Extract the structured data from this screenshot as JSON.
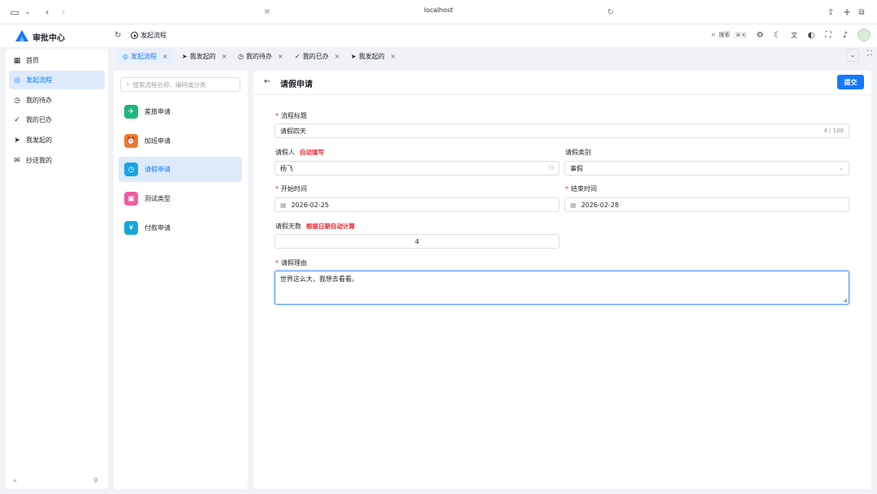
{
  "browser": {
    "url": "localhost"
  },
  "app": {
    "title": "审批中心"
  },
  "header": {
    "breadcrumb": "发起流程",
    "search_label": "搜索",
    "search_shortcut": "⌘ K"
  },
  "sidebar": {
    "items": [
      {
        "label": "首页",
        "icon": "dashboard-icon"
      },
      {
        "label": "发起流程",
        "icon": "play-circle-icon",
        "active": true
      },
      {
        "label": "我的待办",
        "icon": "clock-icon"
      },
      {
        "label": "我的已办",
        "icon": "check-circle-icon"
      },
      {
        "label": "我发起的",
        "icon": "send-icon"
      },
      {
        "label": "抄送我的",
        "icon": "mail-icon"
      }
    ]
  },
  "tabs": [
    {
      "label": "发起流程",
      "active": true
    },
    {
      "label": "我发起的"
    },
    {
      "label": "我的待办"
    },
    {
      "label": "我的已办"
    },
    {
      "label": "我发起的"
    }
  ],
  "process_list": {
    "search_placeholder": "搜索流程名称、编码或分类",
    "items": [
      {
        "label": "差旅申请",
        "color": "#1fb67a"
      },
      {
        "label": "加班申请",
        "color": "#f07a2a"
      },
      {
        "label": "请假申请",
        "color": "#1aa3e8",
        "active": true
      },
      {
        "label": "测试类型",
        "color": "#f05ca0"
      },
      {
        "label": "付款申请",
        "color": "#17a6d8"
      }
    ]
  },
  "form": {
    "title": "请假申请",
    "submit_label": "提交",
    "fields": {
      "title": {
        "label": "流程标题",
        "value": "请假四天",
        "counter": "4 / 100"
      },
      "applicant": {
        "label": "请假人",
        "hint": "自动填写",
        "value": "杨飞"
      },
      "category": {
        "label": "请假类别",
        "value": "事假"
      },
      "start": {
        "label": "开始时间",
        "value": "2026-02-25"
      },
      "end": {
        "label": "结束时间",
        "value": "2026-02-28"
      },
      "days": {
        "label": "请假天数",
        "hint": "根据日期自动计算",
        "value": "4"
      },
      "reason": {
        "label": "请假理由",
        "value": "世界这么大，我想去看看。"
      }
    }
  },
  "colors": {
    "accent": "#1677ff",
    "required": "#f5222d"
  }
}
